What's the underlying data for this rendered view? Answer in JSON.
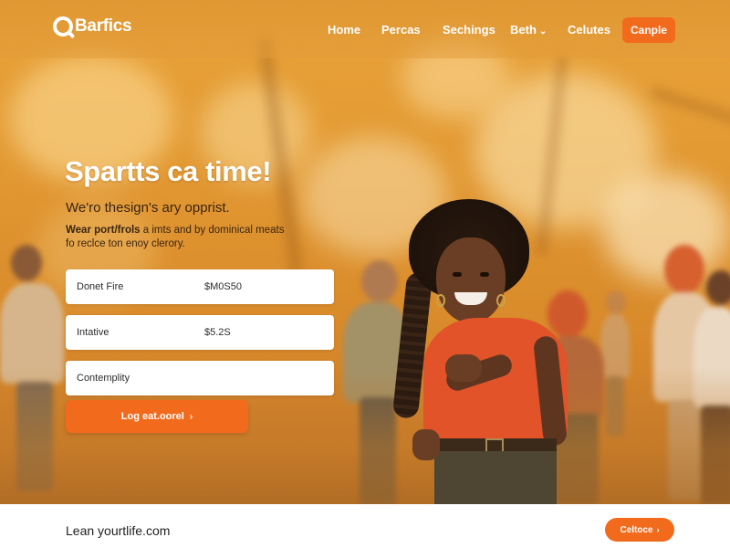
{
  "header": {
    "logo_text": "Barfics",
    "logo_icon": "magnifier-logo-icon",
    "nav": [
      {
        "label": "Home"
      },
      {
        "label": "Percas"
      },
      {
        "label": "Sechings"
      },
      {
        "label": "Beth",
        "icon": "chevron-down-icon"
      },
      {
        "label": "Celutes"
      }
    ],
    "cta_label": "Canple"
  },
  "hero": {
    "title": "Spartts ca time!",
    "subtitle": "We'ro thesign's ary opprist.",
    "description_strong": "Wear port/frols",
    "description_rest": "a imts and by dominical meats fo reclce ton enoy clerory.",
    "fields": [
      {
        "label": "Donet Fire",
        "value": "$M0S50"
      },
      {
        "label": "Intative",
        "value": "$5.2S"
      },
      {
        "label": "Contemplity",
        "value": ""
      }
    ],
    "cta_label": "Log eat.oorel",
    "cta_icon": "chevron-right-icon"
  },
  "footer": {
    "text": "Lean yourtlife.com",
    "button_label": "Celtoce",
    "button_icon": "chevron-right-icon"
  },
  "colors": {
    "accent": "#f26b1d",
    "hero_base": "#e39a33",
    "text_dark": "#3a2412"
  }
}
